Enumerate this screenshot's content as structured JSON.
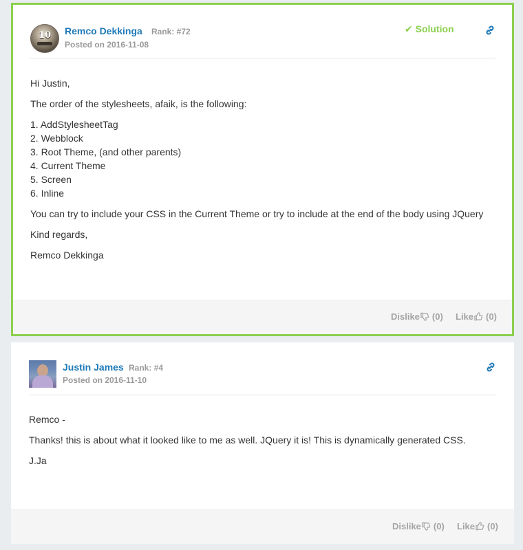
{
  "posts": [
    {
      "author": "Remco Dekkinga",
      "rank": "Rank: #72",
      "posted": "Posted on 2016-11-08",
      "avatar_badge": "10",
      "solution_label": "Solution",
      "body": [
        "Hi Justin,",
        "The order of the stylesheets, afaik, is the following:",
        "1. AddStylesheetTag",
        "2. Webblock",
        "3. Root Theme, (and other parents)",
        "4. Current Theme",
        "5. Screen",
        "6. Inline",
        "You can try to include your CSS in the Current Theme or try to include at the end of the body using JQuery",
        "Kind regards,",
        "Remco Dekkinga"
      ],
      "dislike_label": "Dislike",
      "dislike_count": "(0)",
      "like_label": "Like",
      "like_count": "(0)"
    },
    {
      "author": "Justin James",
      "rank": "Rank: #4",
      "posted": "Posted on 2016-11-10",
      "body": [
        "Remco -",
        "Thanks! this is about what it looked like to me as well. JQuery it is! This is dynamically generated CSS.",
        "J.Ja"
      ],
      "dislike_label": "Dislike",
      "dislike_count": "(0)",
      "like_label": "Like",
      "like_count": "(0)"
    }
  ],
  "colors": {
    "accent_link": "#1e7ab8",
    "solution_green": "#8cd04f",
    "muted": "#9a9a9a",
    "page_bg": "#e9edf0"
  },
  "icons": {
    "solution": "check-icon",
    "permalink": "link-icon",
    "dislike": "thumbs-down-icon",
    "like": "thumbs-up-icon"
  }
}
